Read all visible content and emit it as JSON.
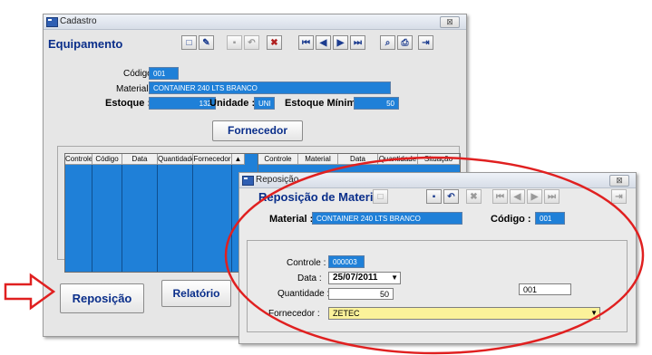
{
  "cadastro": {
    "window_title": "Cadastro",
    "close_label": "⊠",
    "heading": "Equipamento",
    "toolbar": [
      "new-doc-icon",
      "edit-icon",
      "save-icon",
      "undo-icon",
      "delete-icon",
      "first-icon",
      "prev-icon",
      "next-icon",
      "last-icon",
      "search-icon",
      "print-icon",
      "exit-icon"
    ],
    "codigo_label": "Código :",
    "codigo_value": "001",
    "material_label": "Material :",
    "material_value": "CONTAINER 240 LTS BRANCO",
    "estoque_label": "Estoque :",
    "estoque_value": "132",
    "unidade_label": "Unidade :",
    "unidade_value": "UNI",
    "estoque_minimo_label": "Estoque Mínimo :",
    "estoque_minimo_value": "50",
    "fornecedor_button": "Fornecedor",
    "left_grid_headers": [
      "Controle",
      "Código",
      "Data",
      "Quantidade",
      "Fornecedor"
    ],
    "right_grid_headers": [
      "Controle",
      "Material",
      "Data",
      "Quantidade",
      "Situação"
    ],
    "reposicao_button": "Reposição",
    "relatorio_button": "Relatório"
  },
  "reposicao": {
    "window_title": "Reposição",
    "close_label": "⊠",
    "heading": "Reposição de Material",
    "material_label": "Material :",
    "material_value": "CONTAINER 240 LTS BRANCO",
    "codigo_label": "Código :",
    "codigo_value": "001",
    "controle_label": "Controle :",
    "controle_value": "000003",
    "data_label": "Data :",
    "data_value": "25/07/2011",
    "quantidade_label": "Quantidade :",
    "quantidade_value": "50",
    "extra_value": "001",
    "fornecedor_label": "Fornecedor :",
    "fornecedor_value": "ZETEC"
  },
  "colors": {
    "field_blue": "#1f80d8",
    "heading_blue": "#0a2e8a",
    "highlight_red": "#e02020",
    "combo_yellow": "#fbf29a"
  }
}
